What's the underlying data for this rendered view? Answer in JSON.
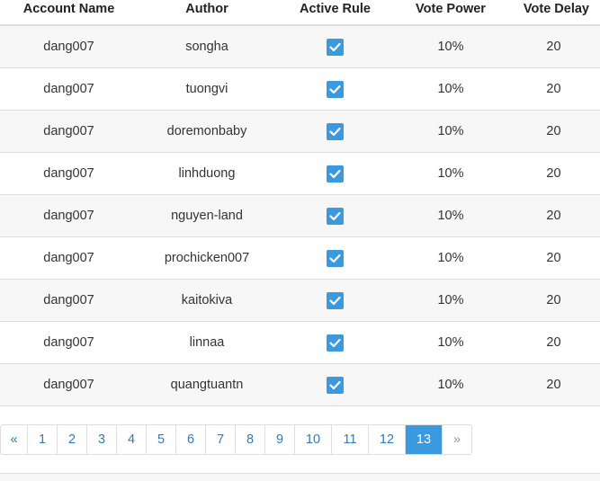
{
  "table": {
    "headers": [
      "Account Name",
      "Author",
      "Active Rule",
      "Vote Power",
      "Vote Delay"
    ],
    "rows": [
      {
        "account": "dang007",
        "author": "songha",
        "active": true,
        "power": "10%",
        "delay": "20"
      },
      {
        "account": "dang007",
        "author": "tuongvi",
        "active": true,
        "power": "10%",
        "delay": "20"
      },
      {
        "account": "dang007",
        "author": "doremonbaby",
        "active": true,
        "power": "10%",
        "delay": "20"
      },
      {
        "account": "dang007",
        "author": "linhduong",
        "active": true,
        "power": "10%",
        "delay": "20"
      },
      {
        "account": "dang007",
        "author": "nguyen-land",
        "active": true,
        "power": "10%",
        "delay": "20"
      },
      {
        "account": "dang007",
        "author": "prochicken007",
        "active": true,
        "power": "10%",
        "delay": "20"
      },
      {
        "account": "dang007",
        "author": "kaitokiva",
        "active": true,
        "power": "10%",
        "delay": "20"
      },
      {
        "account": "dang007",
        "author": "linnaa",
        "active": true,
        "power": "10%",
        "delay": "20"
      },
      {
        "account": "dang007",
        "author": "quangtuantn",
        "active": true,
        "power": "10%",
        "delay": "20"
      }
    ]
  },
  "pagination": {
    "prev_label": "«",
    "next_label": "»",
    "pages": [
      "1",
      "2",
      "3",
      "4",
      "5",
      "6",
      "7",
      "8",
      "9",
      "10",
      "11",
      "12",
      "13"
    ],
    "current": "13"
  },
  "colors": {
    "accent": "#3b99e0",
    "link": "#337ab7"
  }
}
